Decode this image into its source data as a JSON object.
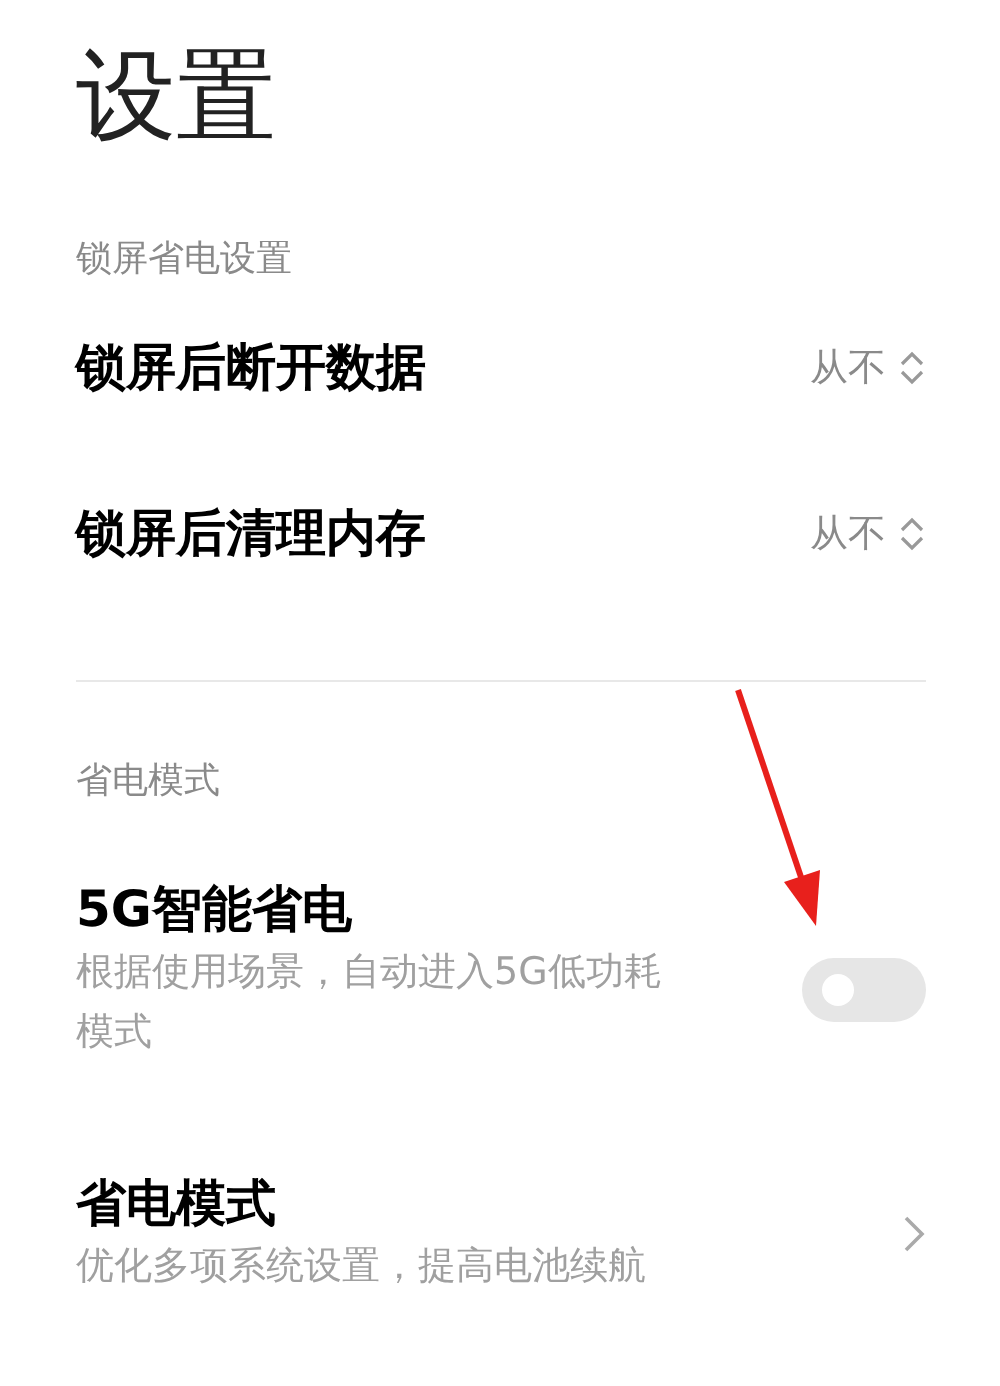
{
  "title": "设置",
  "sections": [
    {
      "header": "锁屏省电设置",
      "items": [
        {
          "kind": "select",
          "label": "锁屏后断开数据",
          "value": "从不"
        },
        {
          "kind": "select",
          "label": "锁屏后清理内存",
          "value": "从不"
        }
      ]
    },
    {
      "header": "省电模式",
      "items": [
        {
          "kind": "toggle",
          "label": "5G智能省电",
          "description": "根据使用场景，自动进入5G低功耗模式",
          "on": false
        },
        {
          "kind": "link",
          "label": "省电模式",
          "description": "优化多项系统设置，提高电池续航"
        }
      ]
    }
  ]
}
